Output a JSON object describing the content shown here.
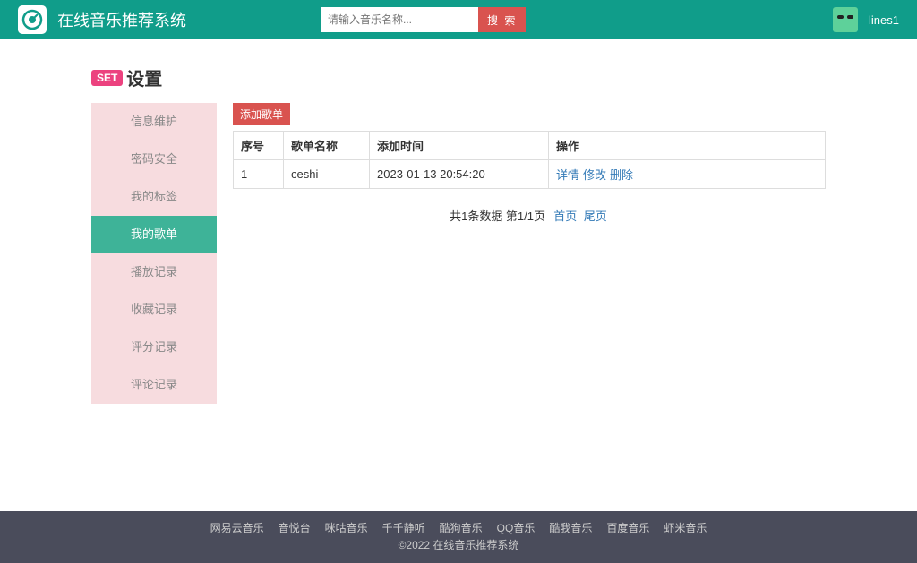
{
  "header": {
    "appTitle": "在线音乐推荐系统",
    "searchPlaceholder": "请输入音乐名称...",
    "searchBtn": "搜 索",
    "username": "lines1"
  },
  "page": {
    "badge": "SET",
    "title": "设置"
  },
  "sidebar": {
    "items": [
      {
        "label": "信息维护",
        "active": false
      },
      {
        "label": "密码安全",
        "active": false
      },
      {
        "label": "我的标签",
        "active": false
      },
      {
        "label": "我的歌单",
        "active": true
      },
      {
        "label": "播放记录",
        "active": false
      },
      {
        "label": "收藏记录",
        "active": false
      },
      {
        "label": "评分记录",
        "active": false
      },
      {
        "label": "评论记录",
        "active": false
      }
    ]
  },
  "content": {
    "addBtn": "添加歌单",
    "columns": [
      "序号",
      "歌单名称",
      "添加时间",
      "操作"
    ],
    "rows": [
      {
        "index": "1",
        "name": "ceshi",
        "time": "2023-01-13 20:54:20",
        "ops": [
          "详情",
          "修改",
          "删除"
        ]
      }
    ],
    "pagerText": "共1条数据  第1/1页",
    "pagerLinks": [
      "首页",
      "尾页"
    ]
  },
  "footer": {
    "links": [
      "网易云音乐",
      "音悦台",
      "咪咕音乐",
      "千千静听",
      "酷狗音乐",
      "QQ音乐",
      "酷我音乐",
      "百度音乐",
      "虾米音乐"
    ],
    "copyright": "©2022 在线音乐推荐系统"
  }
}
